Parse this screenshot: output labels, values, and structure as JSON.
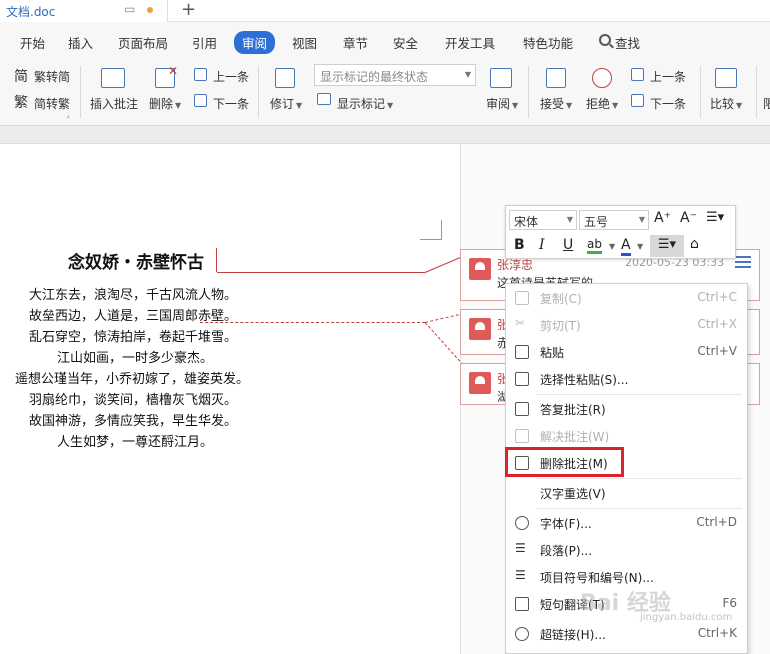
{
  "titlebar": {
    "doc_title": "文档.doc"
  },
  "menu": {
    "tabs": [
      "开始",
      "插入",
      "页面布局",
      "引用",
      "审阅",
      "视图",
      "章节",
      "安全",
      "开发工具",
      "特色功能",
      "查找"
    ],
    "active": "审阅"
  },
  "ribbon": {
    "fanzhuanjian": "繁转简",
    "jianzhuanfan": "简转繁",
    "insert_comment": "插入批注",
    "delete": "删除",
    "prev": "上一条",
    "next": "下一条",
    "revise": "修订",
    "display_state": "显示标记的最终状态",
    "show_markup": "显示标记",
    "review": "审阅",
    "accept": "接受",
    "reject": "拒绝",
    "prev2": "上一条",
    "next2": "下一条",
    "compare": "比较",
    "cut_off": "限"
  },
  "document": {
    "title": "念奴娇・赤壁怀古",
    "lines": [
      "大江东去，浪淘尽，千古风流人物。",
      "故垒西边，人道是，三国周郎赤壁。",
      "乱石穿空，惊涛拍岸，卷起千堆雪。",
      "江山如画，一时多少豪杰。",
      "遥想公瑾当年，小乔初嫁了，雄姿英发。",
      "羽扇纶巾，谈笑间，樯橹灰飞烟灭。",
      "故国神游，多情应笑我，早生华发。",
      "人生如梦，一尊还酹江月。"
    ]
  },
  "comments": [
    {
      "author": "张淳忠",
      "time": "2020-05-23 03:33",
      "text": "这首诗是苏轼写的"
    },
    {
      "author": "张",
      "time": "",
      "text": "赤"
    },
    {
      "author": "张",
      "time": "",
      "text": "湖"
    }
  ],
  "minibar": {
    "font": "宋体",
    "size": "五号",
    "grow": "A⁺",
    "shrink": "A⁻",
    "bold": "B",
    "italic": "I",
    "underline": "U",
    "highlight": "ab",
    "fontcolor": "A"
  },
  "context_menu": [
    {
      "label": "复制(C)",
      "shortcut": "Ctrl+C",
      "disabled": true,
      "icon": "copy-icon"
    },
    {
      "label": "剪切(T)",
      "shortcut": "Ctrl+X",
      "disabled": true,
      "icon": "scissors-icon"
    },
    {
      "label": "粘贴",
      "shortcut": "Ctrl+V",
      "disabled": false,
      "icon": "paste-icon"
    },
    {
      "label": "选择性粘贴(S)...",
      "shortcut": "",
      "disabled": false,
      "icon": "paste-special-icon"
    },
    {
      "label": "答复批注(R)",
      "shortcut": "",
      "disabled": false,
      "icon": "reply-comment-icon"
    },
    {
      "label": "解决批注(W)",
      "shortcut": "",
      "disabled": true,
      "icon": "resolve-comment-icon"
    },
    {
      "label": "删除批注(M)",
      "shortcut": "",
      "disabled": false,
      "icon": "delete-comment-icon"
    },
    {
      "label": "汉字重选(V)",
      "shortcut": "",
      "disabled": false,
      "icon": ""
    },
    {
      "label": "字体(F)...",
      "shortcut": "Ctrl+D",
      "disabled": false,
      "icon": "font-icon"
    },
    {
      "label": "段落(P)...",
      "shortcut": "",
      "disabled": false,
      "icon": "paragraph-icon"
    },
    {
      "label": "项目符号和编号(N)...",
      "shortcut": "",
      "disabled": false,
      "icon": "bullets-icon"
    },
    {
      "label": "短句翻译(T)",
      "shortcut": "F6",
      "disabled": false,
      "icon": "translate-icon"
    },
    {
      "label": "超链接(H)...",
      "shortcut": "Ctrl+K",
      "disabled": false,
      "icon": "hyperlink-icon"
    }
  ],
  "watermark": {
    "main": "Bai 经验",
    "sub": "jingyan.baidu.com"
  },
  "colors": {
    "accent": "#2e6fd6",
    "comment": "#c04040",
    "highlight_box": "#d9232d"
  }
}
